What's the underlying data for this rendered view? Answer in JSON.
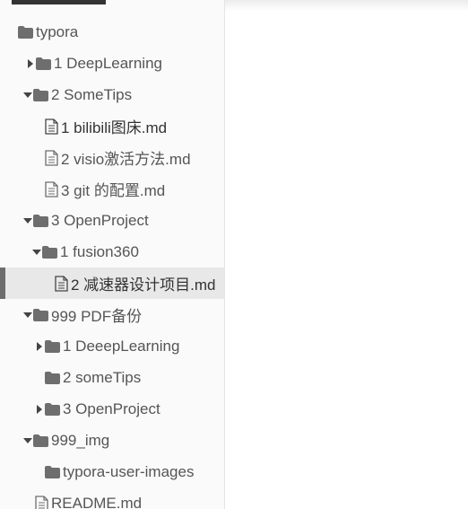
{
  "sidebar": {
    "tree": [
      {
        "label": "typora",
        "icon": "folder-icon",
        "type": "folder",
        "expanded": true
      },
      {
        "label": "1 DeepLearning",
        "icon": "folder-icon",
        "type": "folder",
        "expanded": false
      },
      {
        "label": "2 SomeTips",
        "icon": "folder-icon",
        "type": "folder",
        "expanded": true
      },
      {
        "label": "1 bilibili图床.md",
        "icon": "file-icon",
        "type": "file"
      },
      {
        "label": "2 visio激活方法.md",
        "icon": "file-icon",
        "type": "file"
      },
      {
        "label": "3 git 的配置.md",
        "icon": "file-icon",
        "type": "file"
      },
      {
        "label": "3 OpenProject",
        "icon": "folder-icon",
        "type": "folder",
        "expanded": true
      },
      {
        "label": "1 fusion360",
        "icon": "folder-icon",
        "type": "folder",
        "expanded": true
      },
      {
        "label": "2 减速器设计项目.md",
        "icon": "file-icon",
        "type": "file",
        "active": true
      },
      {
        "label": "999 PDF备份",
        "icon": "folder-icon",
        "type": "folder",
        "expanded": true
      },
      {
        "label": "1 DeeepLearning",
        "icon": "folder-icon",
        "type": "folder",
        "expanded": false
      },
      {
        "label": "2 someTips",
        "icon": "folder-icon",
        "type": "folder"
      },
      {
        "label": "3 OpenProject",
        "icon": "folder-icon",
        "type": "folder",
        "expanded": false
      },
      {
        "label": "999_img",
        "icon": "folder-icon",
        "type": "folder",
        "expanded": true
      },
      {
        "label": "typora-user-images",
        "icon": "folder-icon",
        "type": "folder"
      },
      {
        "label": "README.md",
        "icon": "file-icon",
        "type": "file"
      }
    ]
  },
  "colors": {
    "sidebar_bg": "#fafafa",
    "active_row_bg": "#e8e8e8",
    "active_marker": "#6d6d6d",
    "icon": "#6e6e6e",
    "text": "#555555"
  }
}
